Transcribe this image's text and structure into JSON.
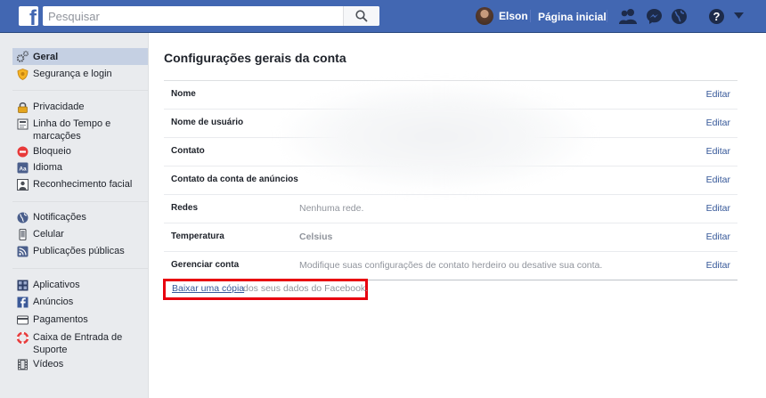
{
  "header": {
    "search_placeholder": "Pesquisar",
    "profile_name": "Elson",
    "home_label": "Página inicial",
    "brand_color": "#4267b2"
  },
  "sidebar": {
    "group1": [
      {
        "label": "Geral",
        "icon": "gear-icon",
        "active": true
      },
      {
        "label": "Segurança e login",
        "icon": "shield-icon"
      }
    ],
    "group2": [
      {
        "label": "Privacidade",
        "icon": "lock-icon"
      },
      {
        "label": "Linha do Tempo e",
        "label2": "marcações",
        "icon": "timeline-icon"
      },
      {
        "label": "Bloqueio",
        "icon": "block-icon"
      },
      {
        "label": "Idioma",
        "icon": "language-icon"
      },
      {
        "label": "Reconhecimento facial",
        "icon": "face-recognition-icon"
      }
    ],
    "group3": [
      {
        "label": "Notificações",
        "icon": "globe-notifications-icon"
      },
      {
        "label": "Celular",
        "icon": "mobile-icon"
      },
      {
        "label": "Publicações públicas",
        "icon": "rss-icon"
      }
    ],
    "group4": [
      {
        "label": "Aplicativos",
        "icon": "apps-icon"
      },
      {
        "label": "Anúncios",
        "icon": "ads-icon"
      },
      {
        "label": "Pagamentos",
        "icon": "payments-icon"
      },
      {
        "label": "Caixa de Entrada de",
        "label2": "Suporte",
        "icon": "lifebuoy-icon"
      },
      {
        "label": "Vídeos",
        "icon": "film-icon"
      }
    ]
  },
  "main": {
    "title": "Configurações gerais da conta",
    "edit_label": "Editar",
    "rows": [
      {
        "label": "Nome",
        "value": ""
      },
      {
        "label": "Nome de usuário",
        "value": ""
      },
      {
        "label": "Contato",
        "value": ""
      },
      {
        "label": "Contato da conta de anúncios",
        "value": ""
      },
      {
        "label": "Redes",
        "value": "Nenhuma rede."
      },
      {
        "label": "Temperatura",
        "value": "Celsius"
      },
      {
        "label": "Gerenciar conta",
        "value": "Modifique suas configurações de contato herdeiro ou desative sua conta."
      }
    ],
    "download_link": "Baixar uma cópia",
    "download_rest": "dos seus dados do Facebook."
  }
}
